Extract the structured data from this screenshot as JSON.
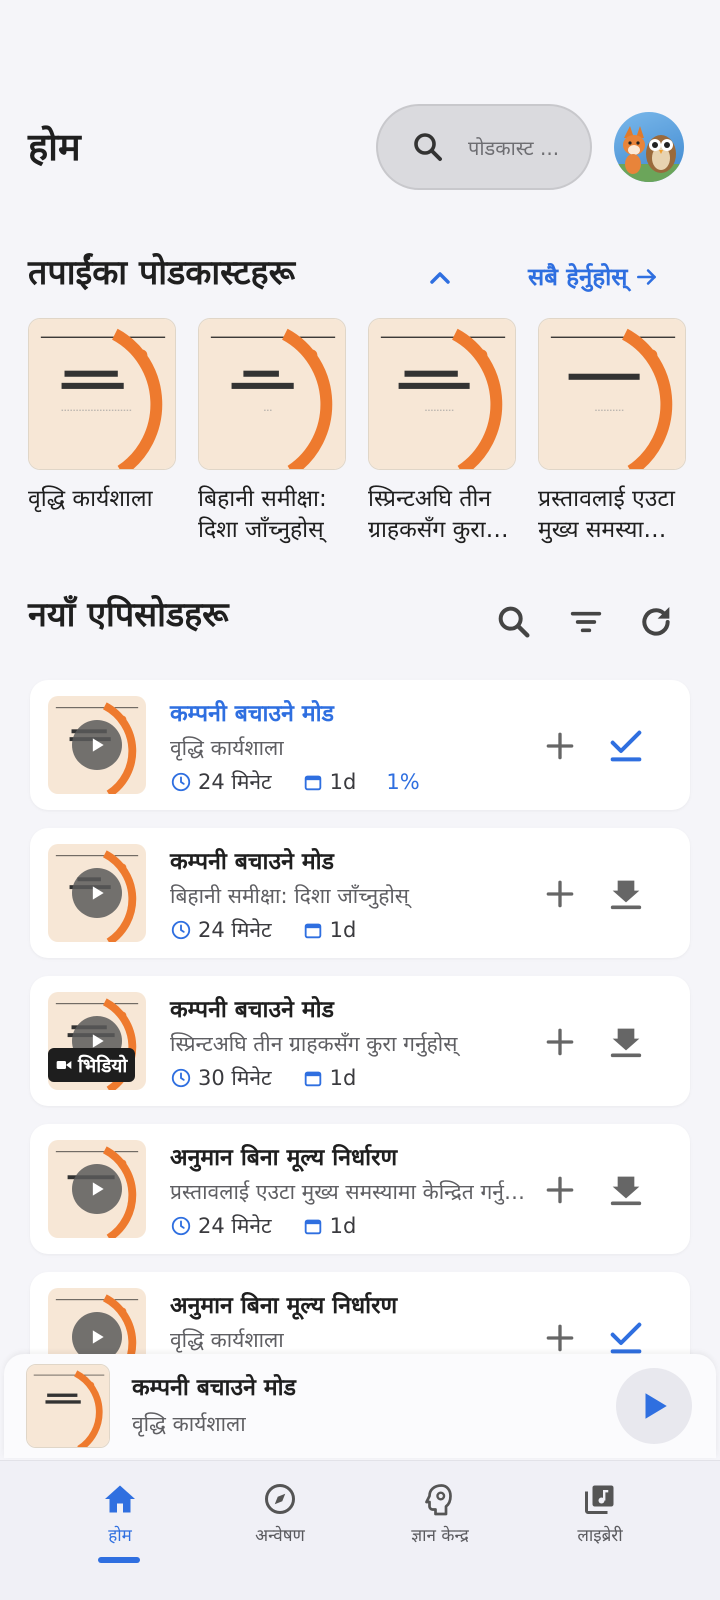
{
  "header": {
    "title": "होम",
    "search_placeholder": "पोडकास्ट ..."
  },
  "podcasts_section": {
    "title": "तपाईंका पोडकास्टहरू",
    "see_all": "सबै हेर्नुहोस्",
    "items": [
      {
        "name": "वृद्धि कार्यशाला"
      },
      {
        "name": "बिहानी समीक्षा: दिशा जाँच्नुहोस्"
      },
      {
        "name": "स्प्रिन्टअघि तीन ग्राहकसँग कुरा गर्नुहोस्"
      },
      {
        "name": "प्रस्तावलाई एउटा मुख्य समस्यामा केन्द्रित गर्नुहोस्"
      }
    ]
  },
  "episodes_section": {
    "title": "नयाँ एपिसोडहरू",
    "items": [
      {
        "title": "कम्पनी बचाउने मोड",
        "podcast": "वृद्धि कार्यशाला",
        "duration": "24 मिनेट",
        "age": "1d",
        "progress": "1%",
        "video": false,
        "status": "played"
      },
      {
        "title": "कम्पनी बचाउने मोड",
        "podcast": "बिहानी समीक्षा: दिशा जाँच्नुहोस्",
        "duration": "24 मिनेट",
        "age": "1d",
        "progress": "",
        "video": false,
        "status": "download"
      },
      {
        "title": "कम्पनी बचाउने मोड",
        "podcast": "स्प्रिन्टअघि तीन ग्राहकसँग कुरा गर्नुहोस्",
        "duration": "30 मिनेट",
        "age": "1d",
        "progress": "",
        "video": true,
        "video_label": "भिडियो",
        "status": "download"
      },
      {
        "title": "अनुमान बिना मूल्य निर्धारण",
        "podcast": "प्रस्तावलाई एउटा मुख्य समस्यामा केन्द्रित गर्नुहोस्",
        "duration": "24 मिनेट",
        "age": "1d",
        "progress": "",
        "video": false,
        "status": "download"
      },
      {
        "title": "अनुमान बिना मूल्य निर्धारण",
        "podcast": "वृद्धि कार्यशाला",
        "duration": "",
        "age": "",
        "progress": "",
        "video": false,
        "status": "played"
      }
    ]
  },
  "mini_player": {
    "title": "कम्पनी बचाउने मोड",
    "podcast": "वृद्धि कार्यशाला"
  },
  "bottom_nav": [
    {
      "label": "होम",
      "icon": "home-icon",
      "active": true
    },
    {
      "label": "अन्वेषण",
      "icon": "compass-icon",
      "active": false
    },
    {
      "label": "ज्ञान केन्द्र",
      "icon": "brain-gear-icon",
      "active": false
    },
    {
      "label": "लाइब्रेरी",
      "icon": "library-music-icon",
      "active": false
    }
  ],
  "colors": {
    "accent": "#2f6fe0",
    "artwork_bg": "#f7e7d6",
    "artwork_arc": "#ee7a2e"
  }
}
